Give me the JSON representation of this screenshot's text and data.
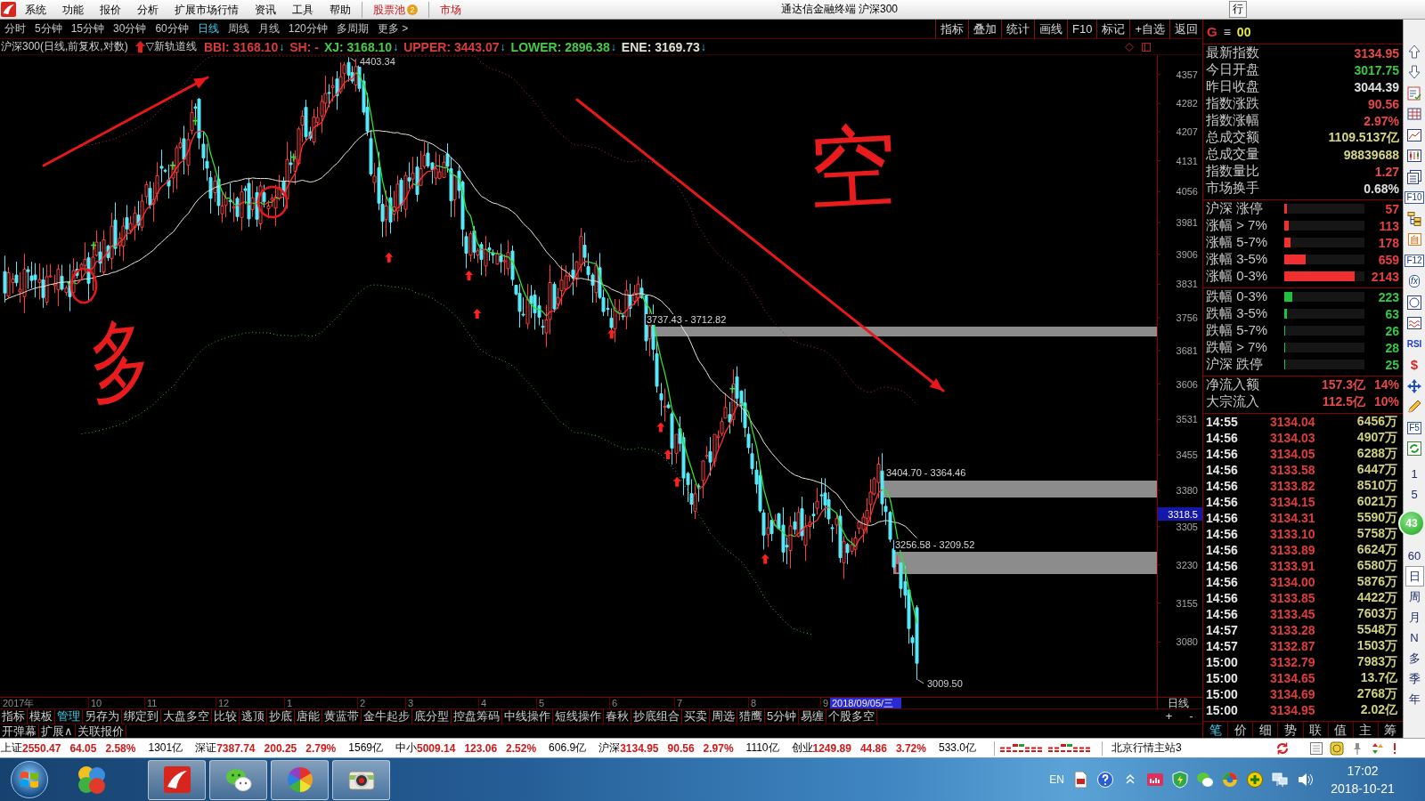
{
  "menu_bar": {
    "items": [
      "系统",
      "功能",
      "报价",
      "分析",
      "扩展市场行情",
      "资讯",
      "工具",
      "帮助"
    ],
    "pool": {
      "label": "股票池",
      "badge": "2"
    },
    "market": "市场",
    "title": "通达信金融终端 沪深300",
    "corner_button": "行"
  },
  "period_tabs": [
    {
      "label": "分时",
      "selected": false
    },
    {
      "label": "5分钟",
      "selected": false
    },
    {
      "label": "15分钟",
      "selected": false
    },
    {
      "label": "30分钟",
      "selected": false
    },
    {
      "label": "60分钟",
      "selected": false
    },
    {
      "label": "日线",
      "selected": true
    },
    {
      "label": "周线",
      "selected": false
    },
    {
      "label": "月线",
      "selected": false
    },
    {
      "label": "120分钟",
      "selected": false
    },
    {
      "label": "多周期",
      "selected": false
    },
    {
      "label": "更多 >",
      "selected": false
    }
  ],
  "chart_buttons": [
    "指标",
    "叠加",
    "统计",
    "画线",
    "F10",
    "标记",
    "+自选",
    "返回"
  ],
  "indicator_header": {
    "title": "沪深300(日线,前复权,对数)",
    "indicator": "▽新轨道线",
    "values": [
      {
        "text": "BBI: 3168.10",
        "arrow": "↓",
        "color": "#d83c3c"
      },
      {
        "text": "SH: -",
        "color": "#d83c3c"
      },
      {
        "text": "XJ: 3168.10",
        "arrow": "↓",
        "color": "#48c848"
      },
      {
        "text": "UPPER: 3443.07",
        "arrow": "↓",
        "color": "#d83c3c"
      },
      {
        "text": "LOWER: 2896.38",
        "arrow": "↓",
        "color": "#48c848"
      },
      {
        "text": "ENE: 3169.73",
        "arrow": "↓",
        "color": "#e0e0d0"
      }
    ]
  },
  "chart": {
    "y_ticks": [
      "4357",
      "4282",
      "4207",
      "4131",
      "4056",
      "3981",
      "3906",
      "3831",
      "3756",
      "3681",
      "3606",
      "3531",
      "3455",
      "3380",
      "3305",
      "3230",
      "3155",
      "3080"
    ],
    "cursor_price": "3318.5",
    "high_label": "4403.34",
    "low_label": "3009.50",
    "zones": [
      {
        "label": "3737.43 - 3712.82"
      },
      {
        "label": "3404.70 - 3364.46"
      },
      {
        "label": "3256.58 - 3209.52"
      }
    ],
    "handwriting": [
      {
        "text": "空"
      },
      {
        "text": "多"
      }
    ]
  },
  "x_axis": {
    "labels": [
      "2017年",
      "10",
      "11",
      "12",
      "1",
      "2",
      "3",
      "4",
      "5",
      "6",
      "7",
      "8",
      "9"
    ],
    "cursor_date": "2018/09/05/三",
    "period": "日线"
  },
  "bottom_tabs": [
    {
      "label": "指标",
      "selected": false
    },
    {
      "label": "模板",
      "selected": false
    },
    {
      "label": "管理",
      "selected": true
    },
    {
      "label": "另存为",
      "selected": false
    },
    {
      "label": "绑定到",
      "selected": false
    },
    {
      "label": "大盘多空",
      "selected": false
    },
    {
      "label": "比较",
      "selected": false
    },
    {
      "label": "逃顶",
      "selected": false
    },
    {
      "label": "抄底",
      "selected": false
    },
    {
      "label": "唐能",
      "selected": false
    },
    {
      "label": "黄蓝带",
      "selected": false
    },
    {
      "label": "金牛起步",
      "selected": false
    },
    {
      "label": "底分型",
      "selected": false
    },
    {
      "label": "控盘筹码",
      "selected": false
    },
    {
      "label": "中线操作",
      "selected": false
    },
    {
      "label": "短线操作",
      "selected": false
    },
    {
      "label": "春秋",
      "selected": false
    },
    {
      "label": "抄底组合",
      "selected": false
    },
    {
      "label": "买卖",
      "selected": false
    },
    {
      "label": "周选",
      "selected": false
    },
    {
      "label": "猎鹰",
      "selected": false
    },
    {
      "label": "5分钟",
      "selected": false
    },
    {
      "label": "易缠",
      "selected": false
    },
    {
      "label": "个股多空",
      "selected": false
    }
  ],
  "zoom_buttons": [
    "+",
    "-"
  ],
  "bottom_links": [
    "开弹幕",
    "扩展∧",
    "关联报价"
  ],
  "right_panel": {
    "header": {
      "market": "G",
      "menu": "≡",
      "code": "00"
    },
    "quotes": [
      {
        "label": "最新指数",
        "value": "3134.95",
        "color": "#e84848"
      },
      {
        "label": "今日开盘",
        "value": "3017.75",
        "color": "#3cc83c"
      },
      {
        "label": "昨日收盘",
        "value": "3044.39",
        "color": "#e0e0e0"
      },
      {
        "label": "指数涨跌",
        "value": "90.56",
        "color": "#e84848"
      },
      {
        "label": "指数涨幅",
        "value": "2.97%",
        "color": "#e84848"
      },
      {
        "label": "总成交额",
        "value": "1109.5137亿",
        "color": "#d8d880"
      },
      {
        "label": "总成交量",
        "value": "98839688",
        "color": "#d8d880"
      },
      {
        "label": "指数量比",
        "value": "1.27",
        "color": "#e84848"
      },
      {
        "label": "市场换手",
        "value": "0.68%",
        "color": "#e0e0e0"
      }
    ],
    "breadth": [
      {
        "label": "沪深 涨停",
        "count": "57",
        "level": 0.035,
        "kind": "up"
      },
      {
        "label": "涨幅 > 7%",
        "count": "113",
        "level": 0.06,
        "kind": "up"
      },
      {
        "label": "涨幅 5-7%",
        "count": "178",
        "level": 0.08,
        "kind": "up"
      },
      {
        "label": "涨幅 3-5%",
        "count": "659",
        "level": 0.27,
        "kind": "up"
      },
      {
        "label": "涨幅 0-3%",
        "count": "2143",
        "level": 0.88,
        "kind": "up"
      },
      {
        "label": "跌幅 0-3%",
        "count": "223",
        "level": 0.1,
        "kind": "down"
      },
      {
        "label": "跌幅 3-5%",
        "count": "63",
        "level": 0.03,
        "kind": "down"
      },
      {
        "label": "跌幅 5-7%",
        "count": "26",
        "level": 0.01,
        "kind": "down"
      },
      {
        "label": "跌幅 > 7%",
        "count": "28",
        "level": 0.01,
        "kind": "down"
      },
      {
        "label": "沪深 跌停",
        "count": "25",
        "level": 0.01,
        "kind": "down"
      }
    ],
    "flows": [
      {
        "label": "净流入额",
        "value": "157.3亿",
        "percent": "14%"
      },
      {
        "label": "大宗流入",
        "value": "112.5亿",
        "percent": "10%"
      }
    ],
    "ticks": [
      {
        "time": "14:55",
        "price": "3134.04",
        "volume": "6456万"
      },
      {
        "time": "14:56",
        "price": "3134.03",
        "volume": "4907万"
      },
      {
        "time": "14:56",
        "price": "3134.05",
        "volume": "6288万"
      },
      {
        "time": "14:56",
        "price": "3133.58",
        "volume": "6447万"
      },
      {
        "time": "14:56",
        "price": "3133.82",
        "volume": "8510万"
      },
      {
        "time": "14:56",
        "price": "3134.15",
        "volume": "6021万"
      },
      {
        "time": "14:56",
        "price": "3134.31",
        "volume": "5590万"
      },
      {
        "time": "14:56",
        "price": "3133.10",
        "volume": "5758万"
      },
      {
        "time": "14:56",
        "price": "3133.89",
        "volume": "6624万"
      },
      {
        "time": "14:56",
        "price": "3133.91",
        "volume": "6580万"
      },
      {
        "time": "14:56",
        "price": "3134.00",
        "volume": "5876万"
      },
      {
        "time": "14:56",
        "price": "3133.85",
        "volume": "4422万"
      },
      {
        "time": "14:56",
        "price": "3133.45",
        "volume": "7603万"
      },
      {
        "time": "14:57",
        "price": "3133.28",
        "volume": "5548万"
      },
      {
        "time": "14:57",
        "price": "3132.87",
        "volume": "1503万"
      },
      {
        "time": "15:00",
        "price": "3132.79",
        "volume": "7983万"
      },
      {
        "time": "15:00",
        "price": "3134.65",
        "volume": "13.7亿"
      },
      {
        "time": "15:00",
        "price": "3134.69",
        "volume": "2768万"
      },
      {
        "time": "15:00",
        "price": "3134.95",
        "volume": "2.02亿"
      }
    ],
    "tabs": [
      {
        "label": "笔",
        "selected": true
      },
      {
        "label": "价",
        "selected": false
      },
      {
        "label": "细",
        "selected": false
      },
      {
        "label": "势",
        "selected": false
      },
      {
        "label": "联",
        "selected": false
      },
      {
        "label": "值",
        "selected": false
      },
      {
        "label": "主",
        "selected": false
      },
      {
        "label": "筹",
        "selected": false
      }
    ]
  },
  "side_toolbar": {
    "text_icons": [
      "F10",
      "自",
      "F12",
      "fx",
      "RSI",
      "$",
      "F5"
    ],
    "period_keys": [
      {
        "label": "1",
        "selected": false
      },
      {
        "label": "5",
        "selected": false
      },
      {
        "label": "60",
        "selected": false
      },
      {
        "label": "日",
        "selected": true
      },
      {
        "label": "周",
        "selected": false
      },
      {
        "label": "月",
        "selected": false
      },
      {
        "label": "N",
        "selected": false
      },
      {
        "label": "多",
        "selected": false
      },
      {
        "label": "季",
        "selected": false
      },
      {
        "label": "年",
        "selected": false
      }
    ]
  },
  "floating_ball": {
    "value": "43"
  },
  "status_bar": {
    "indices": [
      {
        "name": "上证",
        "price": "2550.47",
        "change": "64.05",
        "percent": "2.58%",
        "amount": "1301亿"
      },
      {
        "name": "深证",
        "price": "7387.74",
        "change": "200.25",
        "percent": "2.79%",
        "amount": "1569亿"
      },
      {
        "name": "中小",
        "price": "5009.14",
        "change": "123.06",
        "percent": "2.52%",
        "amount": "606.9亿"
      },
      {
        "name": "沪深",
        "price": "3134.95",
        "change": "90.56",
        "percent": "2.97%",
        "amount": "1110亿"
      },
      {
        "name": "创业",
        "price": "1249.89",
        "change": "44.86",
        "percent": "3.72%",
        "amount": "533.0亿"
      }
    ],
    "server": "北京行情主站3"
  },
  "taskbar": {
    "language": "EN",
    "time": "17:02",
    "date": "2018-10-21"
  }
}
